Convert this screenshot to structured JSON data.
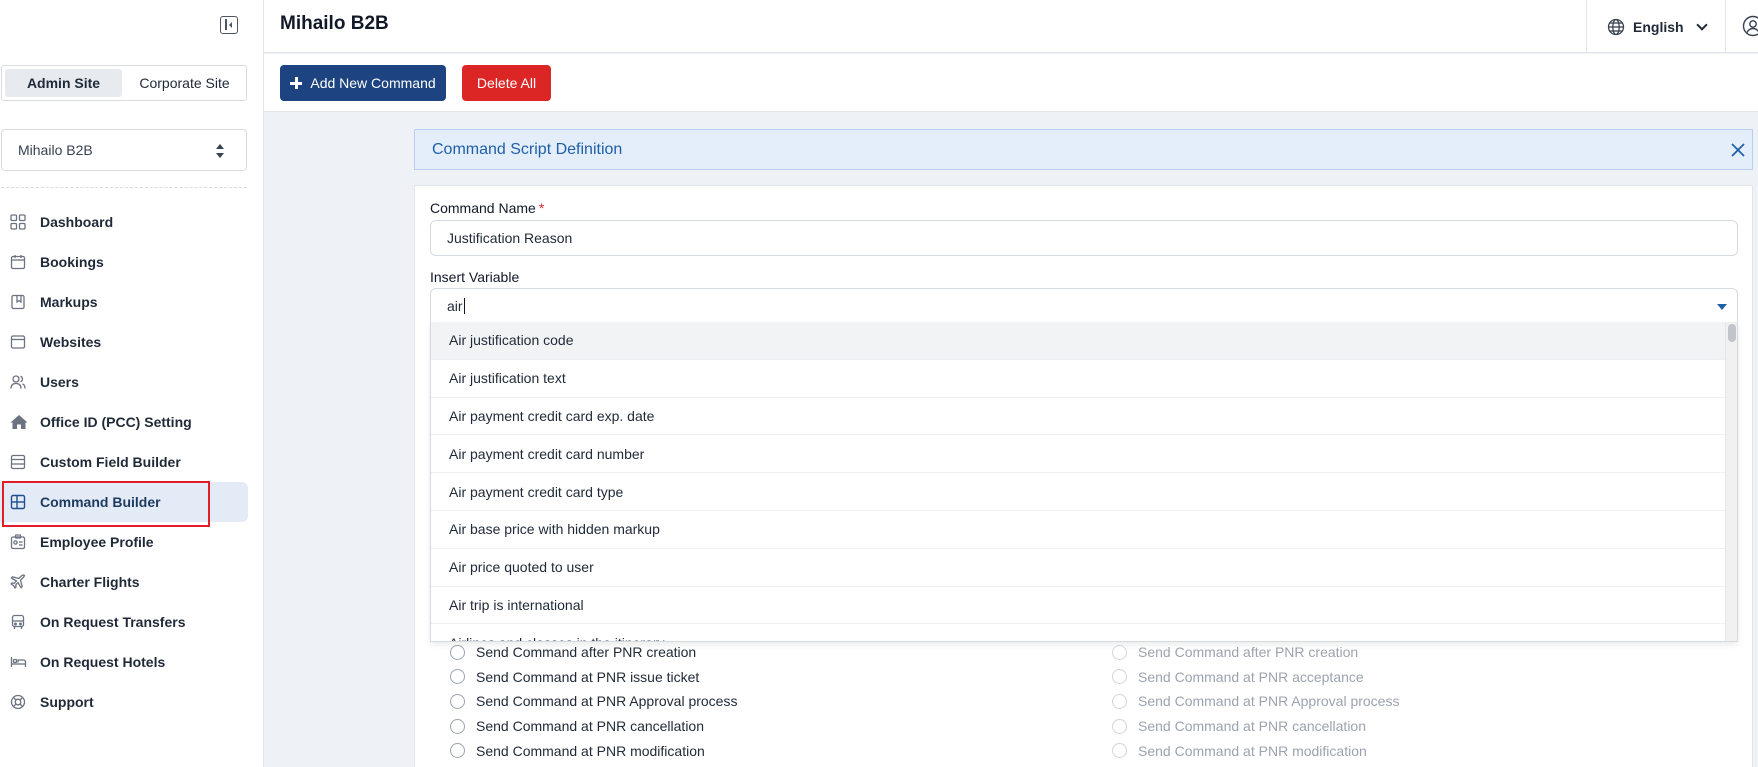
{
  "app": {
    "title": "Mihailo B2B"
  },
  "header": {
    "language": "English"
  },
  "sidebar": {
    "site_tabs": [
      {
        "label": "Admin Site",
        "active": true
      },
      {
        "label": "Corporate Site",
        "active": false
      }
    ],
    "company_select": {
      "value": "Mihailo B2B"
    },
    "items": [
      {
        "label": "Dashboard",
        "icon": "grid-icon"
      },
      {
        "label": "Bookings",
        "icon": "calendar-icon"
      },
      {
        "label": "Markups",
        "icon": "bookmark-icon"
      },
      {
        "label": "Websites",
        "icon": "browser-icon"
      },
      {
        "label": "Users",
        "icon": "users-icon"
      },
      {
        "label": "Office ID (PCC) Setting",
        "icon": "home-icon"
      },
      {
        "label": "Custom Field Builder",
        "icon": "list-icon"
      },
      {
        "label": "Command Builder",
        "icon": "layout-icon",
        "active": true
      },
      {
        "label": "Employee Profile",
        "icon": "id-card-icon"
      },
      {
        "label": "Charter Flights",
        "icon": "plane-icon"
      },
      {
        "label": "On Request Transfers",
        "icon": "bus-icon"
      },
      {
        "label": "On Request Hotels",
        "icon": "bed-icon"
      },
      {
        "label": "Support",
        "icon": "lifebuoy-icon"
      }
    ]
  },
  "toolbar": {
    "add_label": "Add New Command",
    "delete_label": "Delete All"
  },
  "panel": {
    "title": "Command Script Definition",
    "command_name": {
      "label": "Command Name",
      "required": "*",
      "value": "Justification Reason"
    },
    "insert_variable": {
      "label": "Insert Variable",
      "value": "air",
      "options": [
        "Air justification code",
        "Air justification text",
        "Air payment credit card exp. date",
        "Air payment credit card number",
        "Air payment credit card type",
        "Air base price with hidden markup",
        "Air price quoted to user",
        "Air trip is international",
        "Airlines and classes in the itinerary"
      ]
    },
    "send_options_left": [
      "Send Command after PNR creation",
      "Send Command at PNR issue ticket",
      "Send Command at PNR Approval process",
      "Send Command at PNR cancellation",
      "Send Command at PNR modification"
    ],
    "send_options_right": [
      "Send Command after PNR creation",
      "Send Command at PNR acceptance",
      "Send Command at PNR Approval process",
      "Send Command at PNR cancellation",
      "Send Command at PNR modification"
    ]
  },
  "colors": {
    "primary": "#1d4380",
    "danger": "#dc2626",
    "highlight": "#e11d2a",
    "banner_bg": "#e4eefb",
    "banner_text": "#1f5fa8"
  }
}
